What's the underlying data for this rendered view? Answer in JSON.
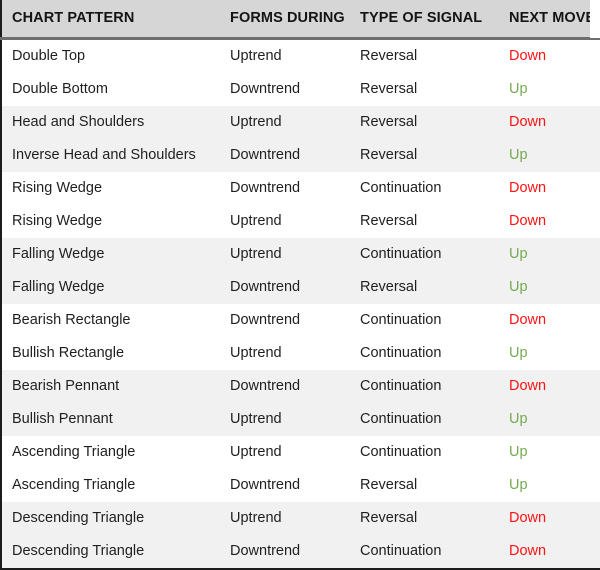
{
  "table": {
    "columns": [
      {
        "key": "pattern",
        "label": "CHART PATTERN"
      },
      {
        "key": "forms_during",
        "label": "FORMS DURING"
      },
      {
        "key": "type_of_signal",
        "label": "TYPE OF SIGNAL"
      },
      {
        "key": "next_move",
        "label": "NEXT MOVE"
      }
    ],
    "rows": [
      {
        "pattern": "Double Top",
        "forms_during": "Uptrend",
        "type_of_signal": "Reversal",
        "next_move": "Down"
      },
      {
        "pattern": "Double Bottom",
        "forms_during": "Downtrend",
        "type_of_signal": "Reversal",
        "next_move": "Up"
      },
      {
        "pattern": "Head and Shoulders",
        "forms_during": "Uptrend",
        "type_of_signal": "Reversal",
        "next_move": "Down"
      },
      {
        "pattern": "Inverse Head and Shoulders",
        "forms_during": "Downtrend",
        "type_of_signal": "Reversal",
        "next_move": "Up"
      },
      {
        "pattern": "Rising Wedge",
        "forms_during": "Downtrend",
        "type_of_signal": "Continuation",
        "next_move": "Down"
      },
      {
        "pattern": "Rising Wedge",
        "forms_during": "Uptrend",
        "type_of_signal": "Reversal",
        "next_move": "Down"
      },
      {
        "pattern": "Falling Wedge",
        "forms_during": "Uptrend",
        "type_of_signal": "Continuation",
        "next_move": "Up"
      },
      {
        "pattern": "Falling Wedge",
        "forms_during": "Downtrend",
        "type_of_signal": "Reversal",
        "next_move": "Up"
      },
      {
        "pattern": "Bearish Rectangle",
        "forms_during": "Downtrend",
        "type_of_signal": "Continuation",
        "next_move": "Down"
      },
      {
        "pattern": "Bullish Rectangle",
        "forms_during": "Uptrend",
        "type_of_signal": "Continuation",
        "next_move": "Up"
      },
      {
        "pattern": "Bearish Pennant",
        "forms_during": "Downtrend",
        "type_of_signal": "Continuation",
        "next_move": "Down"
      },
      {
        "pattern": "Bullish Pennant",
        "forms_during": "Uptrend",
        "type_of_signal": "Continuation",
        "next_move": "Up"
      },
      {
        "pattern": "Ascending Triangle",
        "forms_during": "Uptrend",
        "type_of_signal": "Continuation",
        "next_move": "Up"
      },
      {
        "pattern": "Ascending Triangle",
        "forms_during": "Downtrend",
        "type_of_signal": "Reversal",
        "next_move": "Up"
      },
      {
        "pattern": "Descending Triangle",
        "forms_during": "Uptrend",
        "type_of_signal": "Reversal",
        "next_move": "Down"
      },
      {
        "pattern": "Descending Triangle",
        "forms_during": "Downtrend",
        "type_of_signal": "Continuation",
        "next_move": "Down"
      }
    ]
  },
  "colors": {
    "header_background": "#d6d6d6",
    "header_text": "#141414",
    "header_rule": "#6f6f6f",
    "row_band_white": "#ffffff",
    "row_band_gray": "#f1f1f1",
    "body_text": "#1f1f1f",
    "move_down": "#ff1414",
    "move_up": "#74ab51",
    "outer_border": "#1c1c1c"
  }
}
